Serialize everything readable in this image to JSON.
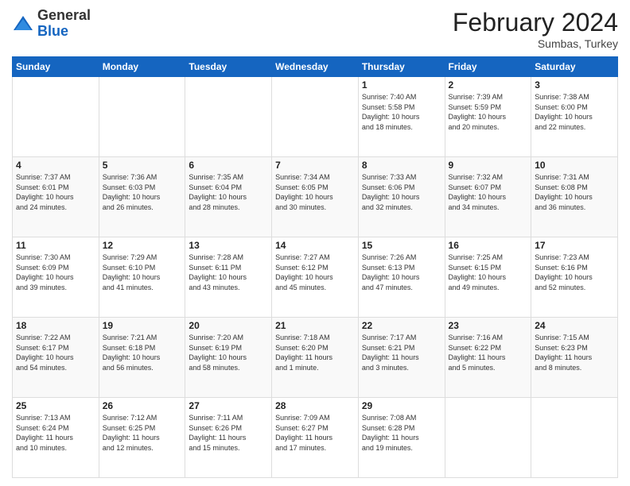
{
  "header": {
    "logo_general": "General",
    "logo_blue": "Blue",
    "month_title": "February 2024",
    "location": "Sumbas, Turkey"
  },
  "days_of_week": [
    "Sunday",
    "Monday",
    "Tuesday",
    "Wednesday",
    "Thursday",
    "Friday",
    "Saturday"
  ],
  "weeks": [
    [
      {
        "day": "",
        "info": ""
      },
      {
        "day": "",
        "info": ""
      },
      {
        "day": "",
        "info": ""
      },
      {
        "day": "",
        "info": ""
      },
      {
        "day": "1",
        "info": "Sunrise: 7:40 AM\nSunset: 5:58 PM\nDaylight: 10 hours\nand 18 minutes."
      },
      {
        "day": "2",
        "info": "Sunrise: 7:39 AM\nSunset: 5:59 PM\nDaylight: 10 hours\nand 20 minutes."
      },
      {
        "day": "3",
        "info": "Sunrise: 7:38 AM\nSunset: 6:00 PM\nDaylight: 10 hours\nand 22 minutes."
      }
    ],
    [
      {
        "day": "4",
        "info": "Sunrise: 7:37 AM\nSunset: 6:01 PM\nDaylight: 10 hours\nand 24 minutes."
      },
      {
        "day": "5",
        "info": "Sunrise: 7:36 AM\nSunset: 6:03 PM\nDaylight: 10 hours\nand 26 minutes."
      },
      {
        "day": "6",
        "info": "Sunrise: 7:35 AM\nSunset: 6:04 PM\nDaylight: 10 hours\nand 28 minutes."
      },
      {
        "day": "7",
        "info": "Sunrise: 7:34 AM\nSunset: 6:05 PM\nDaylight: 10 hours\nand 30 minutes."
      },
      {
        "day": "8",
        "info": "Sunrise: 7:33 AM\nSunset: 6:06 PM\nDaylight: 10 hours\nand 32 minutes."
      },
      {
        "day": "9",
        "info": "Sunrise: 7:32 AM\nSunset: 6:07 PM\nDaylight: 10 hours\nand 34 minutes."
      },
      {
        "day": "10",
        "info": "Sunrise: 7:31 AM\nSunset: 6:08 PM\nDaylight: 10 hours\nand 36 minutes."
      }
    ],
    [
      {
        "day": "11",
        "info": "Sunrise: 7:30 AM\nSunset: 6:09 PM\nDaylight: 10 hours\nand 39 minutes."
      },
      {
        "day": "12",
        "info": "Sunrise: 7:29 AM\nSunset: 6:10 PM\nDaylight: 10 hours\nand 41 minutes."
      },
      {
        "day": "13",
        "info": "Sunrise: 7:28 AM\nSunset: 6:11 PM\nDaylight: 10 hours\nand 43 minutes."
      },
      {
        "day": "14",
        "info": "Sunrise: 7:27 AM\nSunset: 6:12 PM\nDaylight: 10 hours\nand 45 minutes."
      },
      {
        "day": "15",
        "info": "Sunrise: 7:26 AM\nSunset: 6:13 PM\nDaylight: 10 hours\nand 47 minutes."
      },
      {
        "day": "16",
        "info": "Sunrise: 7:25 AM\nSunset: 6:15 PM\nDaylight: 10 hours\nand 49 minutes."
      },
      {
        "day": "17",
        "info": "Sunrise: 7:23 AM\nSunset: 6:16 PM\nDaylight: 10 hours\nand 52 minutes."
      }
    ],
    [
      {
        "day": "18",
        "info": "Sunrise: 7:22 AM\nSunset: 6:17 PM\nDaylight: 10 hours\nand 54 minutes."
      },
      {
        "day": "19",
        "info": "Sunrise: 7:21 AM\nSunset: 6:18 PM\nDaylight: 10 hours\nand 56 minutes."
      },
      {
        "day": "20",
        "info": "Sunrise: 7:20 AM\nSunset: 6:19 PM\nDaylight: 10 hours\nand 58 minutes."
      },
      {
        "day": "21",
        "info": "Sunrise: 7:18 AM\nSunset: 6:20 PM\nDaylight: 11 hours\nand 1 minute."
      },
      {
        "day": "22",
        "info": "Sunrise: 7:17 AM\nSunset: 6:21 PM\nDaylight: 11 hours\nand 3 minutes."
      },
      {
        "day": "23",
        "info": "Sunrise: 7:16 AM\nSunset: 6:22 PM\nDaylight: 11 hours\nand 5 minutes."
      },
      {
        "day": "24",
        "info": "Sunrise: 7:15 AM\nSunset: 6:23 PM\nDaylight: 11 hours\nand 8 minutes."
      }
    ],
    [
      {
        "day": "25",
        "info": "Sunrise: 7:13 AM\nSunset: 6:24 PM\nDaylight: 11 hours\nand 10 minutes."
      },
      {
        "day": "26",
        "info": "Sunrise: 7:12 AM\nSunset: 6:25 PM\nDaylight: 11 hours\nand 12 minutes."
      },
      {
        "day": "27",
        "info": "Sunrise: 7:11 AM\nSunset: 6:26 PM\nDaylight: 11 hours\nand 15 minutes."
      },
      {
        "day": "28",
        "info": "Sunrise: 7:09 AM\nSunset: 6:27 PM\nDaylight: 11 hours\nand 17 minutes."
      },
      {
        "day": "29",
        "info": "Sunrise: 7:08 AM\nSunset: 6:28 PM\nDaylight: 11 hours\nand 19 minutes."
      },
      {
        "day": "",
        "info": ""
      },
      {
        "day": "",
        "info": ""
      }
    ]
  ]
}
